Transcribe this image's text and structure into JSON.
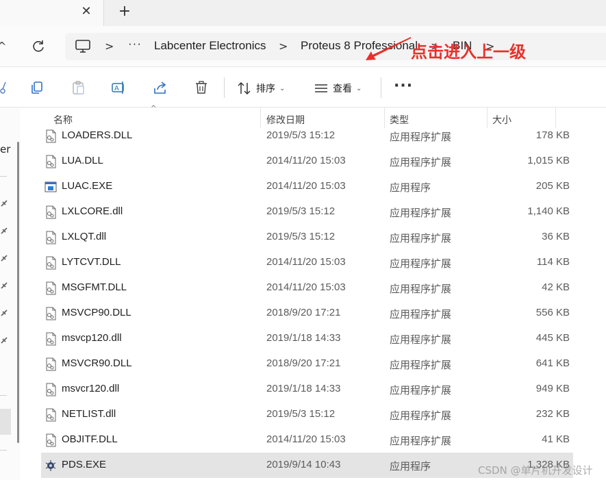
{
  "tab": {
    "close_glyph": "✕",
    "add_glyph": "+"
  },
  "nav": {
    "up_glyph": "^",
    "refresh_icon": "refresh-icon"
  },
  "address": {
    "pc_icon": "computer-icon",
    "separator": ">",
    "ellipsis": "···",
    "crumbs": [
      "Labcenter Electronics",
      "Proteus 8 Professional",
      "BIN"
    ]
  },
  "annotation": {
    "text": "点击进入上一级",
    "color": "#e8302a"
  },
  "toolbar": {
    "icons": [
      "scissors-icon",
      "copy-icon",
      "paste-icon",
      "rename-icon",
      "share-icon",
      "delete-icon"
    ],
    "sort_label": "排序",
    "view_label": "查看",
    "chevron": "⌄",
    "more_label": "···"
  },
  "navpane": {
    "partial_text": "er"
  },
  "columns": {
    "name": "名称",
    "date": "修改日期",
    "type": "类型",
    "size": "大小"
  },
  "files": [
    {
      "name": "LOADERS.DLL",
      "date": "2019/5/3 15:12",
      "type": "应用程序扩展",
      "size": "178 KB",
      "icon": "dll"
    },
    {
      "name": "LUA.DLL",
      "date": "2014/11/20 15:03",
      "type": "应用程序扩展",
      "size": "1,015 KB",
      "icon": "dll"
    },
    {
      "name": "LUAC.EXE",
      "date": "2014/11/20 15:03",
      "type": "应用程序",
      "size": "205 KB",
      "icon": "exe"
    },
    {
      "name": "LXLCORE.dll",
      "date": "2019/5/3 15:12",
      "type": "应用程序扩展",
      "size": "1,140 KB",
      "icon": "dll"
    },
    {
      "name": "LXLQT.dll",
      "date": "2019/5/3 15:12",
      "type": "应用程序扩展",
      "size": "36 KB",
      "icon": "dll"
    },
    {
      "name": "LYTCVT.DLL",
      "date": "2014/11/20 15:03",
      "type": "应用程序扩展",
      "size": "114 KB",
      "icon": "dll"
    },
    {
      "name": "MSGFMT.DLL",
      "date": "2014/11/20 15:03",
      "type": "应用程序扩展",
      "size": "42 KB",
      "icon": "dll"
    },
    {
      "name": "MSVCP90.DLL",
      "date": "2018/9/20 17:21",
      "type": "应用程序扩展",
      "size": "556 KB",
      "icon": "dll"
    },
    {
      "name": "msvcp120.dll",
      "date": "2019/1/18 14:33",
      "type": "应用程序扩展",
      "size": "445 KB",
      "icon": "dll"
    },
    {
      "name": "MSVCR90.DLL",
      "date": "2018/9/20 17:21",
      "type": "应用程序扩展",
      "size": "641 KB",
      "icon": "dll"
    },
    {
      "name": "msvcr120.dll",
      "date": "2019/1/18 14:33",
      "type": "应用程序扩展",
      "size": "949 KB",
      "icon": "dll"
    },
    {
      "name": "NETLIST.dll",
      "date": "2019/5/3 15:12",
      "type": "应用程序扩展",
      "size": "232 KB",
      "icon": "dll"
    },
    {
      "name": "OBJITF.DLL",
      "date": "2014/11/20 15:03",
      "type": "应用程序扩展",
      "size": "41 KB",
      "icon": "dll"
    },
    {
      "name": "PDS.EXE",
      "date": "2019/9/14 10:43",
      "type": "应用程序",
      "size": "1,328 KB",
      "icon": "pds",
      "selected": true
    }
  ],
  "watermark": "CSDN @单片机开发设计"
}
